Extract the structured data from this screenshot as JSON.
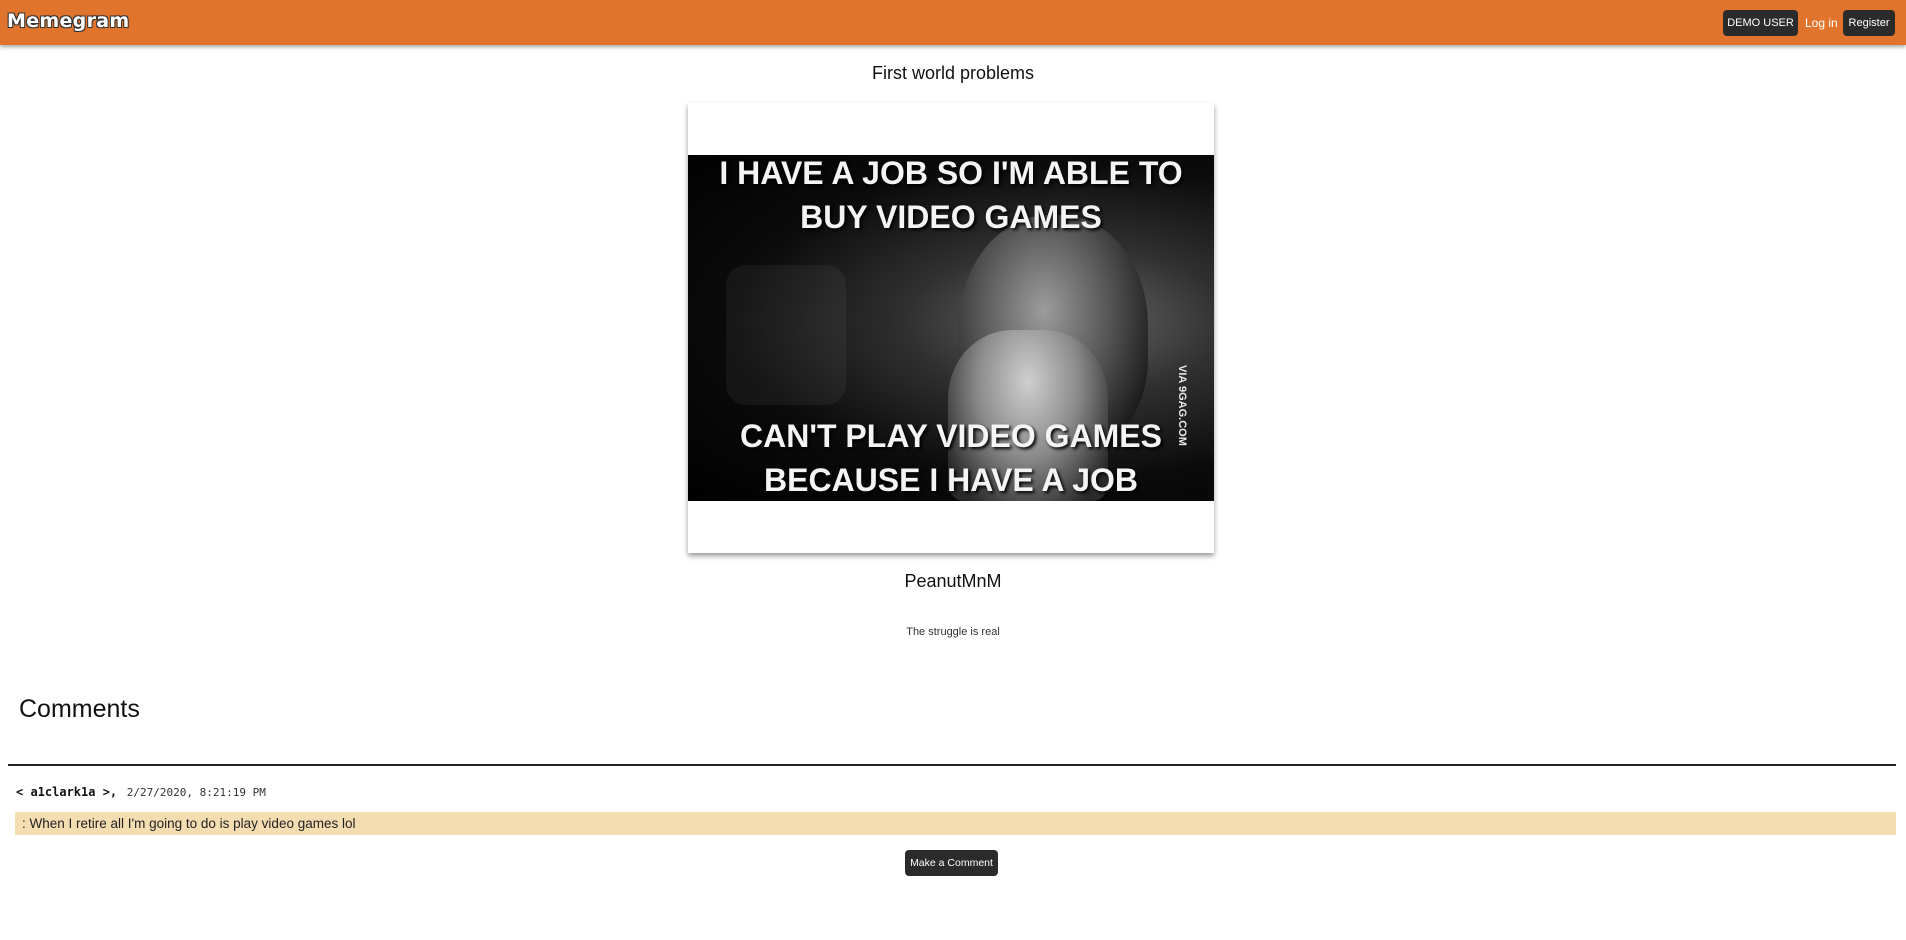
{
  "navbar": {
    "brand": "Memegram",
    "demo_user_label": "DEMO USER",
    "login_label": "Log in",
    "register_label": "Register"
  },
  "post": {
    "title": "First world problems",
    "meme_top_text": "I HAVE A JOB SO I'M ABLE TO BUY VIDEO GAMES",
    "meme_bottom_text": "CAN'T PLAY VIDEO GAMES BECAUSE I HAVE A JOB",
    "meme_watermark": "VIA 9GAG.COM",
    "author": "PeanutMnM",
    "caption": "The struggle is real"
  },
  "comments": {
    "heading": "Comments",
    "items": [
      {
        "user": "< a1clark1a >,",
        "timestamp": "2/27/2020, 8:21:19 PM",
        "text": ": When I retire all I'm going to do is play video games lol"
      }
    ],
    "make_comment_label": "Make a Comment"
  },
  "colors": {
    "navbar": "#e1742c",
    "button": "#2b2b2b",
    "comment_bg": "#f5ddb2"
  }
}
